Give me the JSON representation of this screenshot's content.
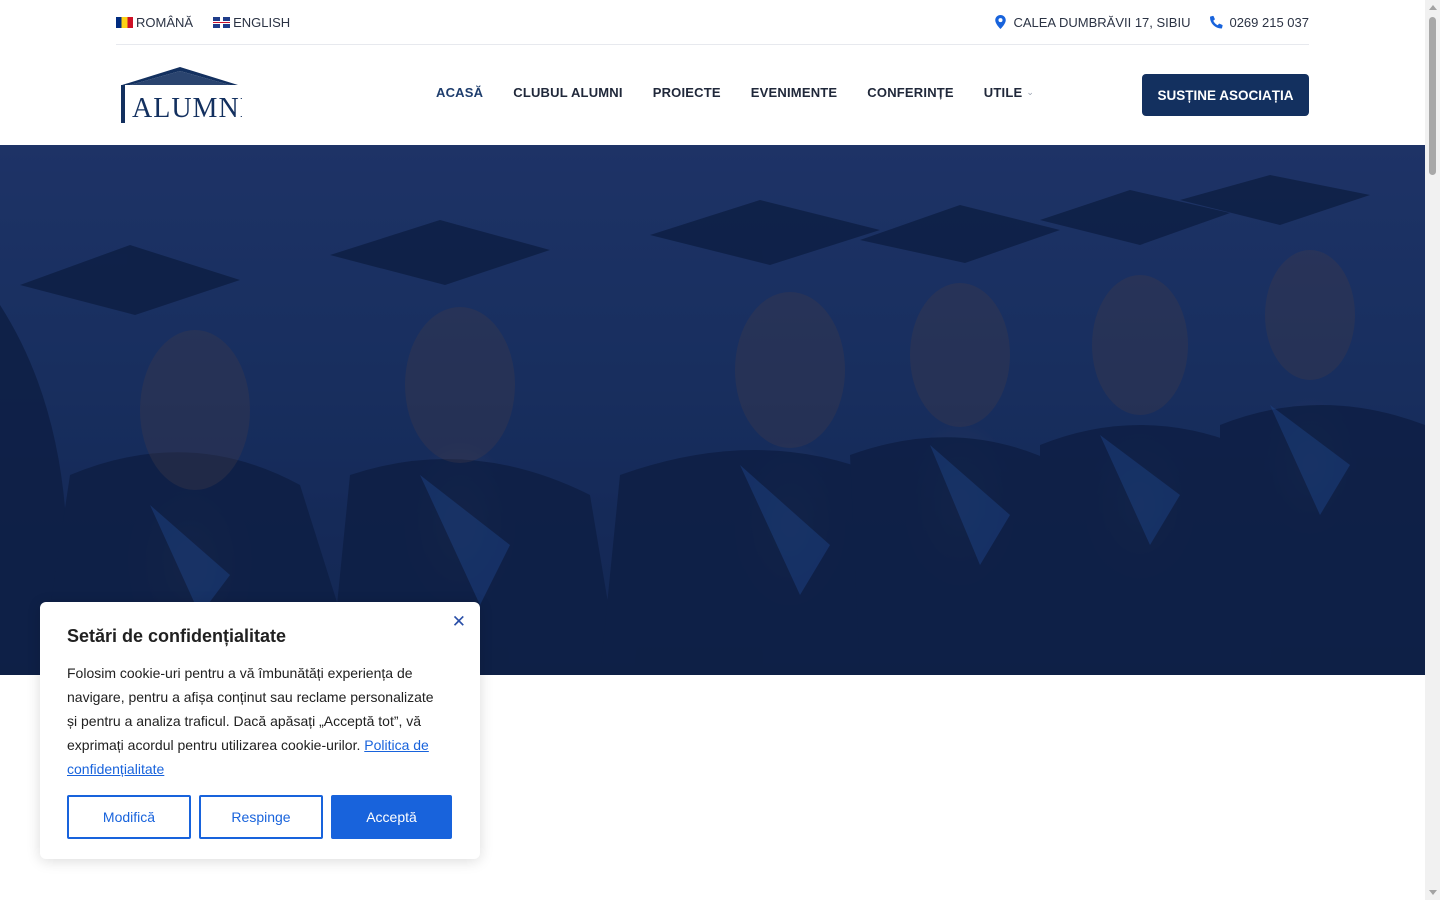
{
  "topbar": {
    "lang_ro": "ROMÂNĂ",
    "lang_en": "ENGLISH",
    "address": "CALEA DUMBRĂVII 17, SIBIU",
    "phone": "0269 215 037"
  },
  "logo": {
    "text": "ALUMNI"
  },
  "nav": {
    "items": [
      {
        "label": "ACASĂ"
      },
      {
        "label": "CLUBUL ALUMNI"
      },
      {
        "label": "PROIECTE"
      },
      {
        "label": "EVENIMENTE"
      },
      {
        "label": "CONFERINȚE"
      },
      {
        "label": "UTILE"
      }
    ],
    "cta": "SUSȚINE ASOCIAȚIA"
  },
  "cookie": {
    "title": "Setări de confidențialitate",
    "body": "Folosim cookie-uri pentru a vă îmbunătăți experiența de navigare, pentru a afișa conținut sau reclame personalizate și pentru a analiza traficul. Dacă apăsați „Acceptă tot”, vă exprimați acordul pentru utilizarea cookie-urilor.",
    "policy_link": "Politica de confidențialitate",
    "btn_modify": "Modifică",
    "btn_reject": "Respinge",
    "btn_accept": "Acceptă"
  },
  "colors": {
    "brand_navy": "#13305f",
    "accent_blue": "#1863dc",
    "hero_tint": "#1a2d55"
  },
  "icons": {
    "location": "map-pin-icon",
    "phone": "phone-icon",
    "close": "close-icon",
    "dropdown": "chevron-down-icon"
  }
}
